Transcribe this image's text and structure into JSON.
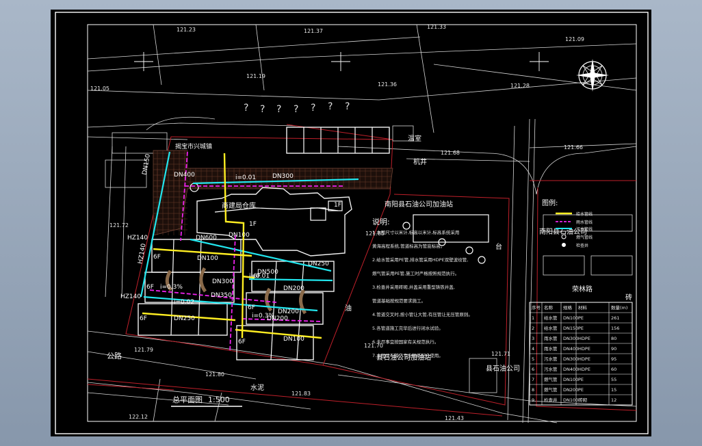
{
  "colors": {
    "background": "#000000",
    "frame": "#ffffff",
    "boundary": "#c0202a",
    "water_pipe": "#ffee22",
    "drain_pipe": "#22e6ee",
    "gas_pipe": "#ee22ee",
    "grid": "#7a4a3a"
  },
  "elevations": [
    "121.23",
    "121.37",
    "121.33",
    "121.09",
    "121.05",
    "121.19",
    "121.36",
    "121.28",
    "121.72",
    "121.79",
    "121.80",
    "121.83",
    "121.85",
    "121.70",
    "121.43",
    "122.12",
    "121.68",
    "121.66",
    "121.71"
  ],
  "site": {
    "neighbor_top": "揭宝市兴城镇",
    "warehouse": "商建局仓库",
    "gas_station": "南阳县石油公司加油站",
    "gas_station_lower": "县石油公司加油站",
    "oil_company": "南阳县石油公司",
    "oil_company_short": "县石油公司",
    "greenhouse": "温室",
    "pump": "机井",
    "street_right": "荣林路",
    "road_south": "公路",
    "road_surface": "水泥",
    "oil": "油",
    "tai": "台",
    "rai": "砖"
  },
  "pipes": [
    "DN400",
    "DN300",
    "DN600",
    "DN100",
    "DN250",
    "DN300",
    "DN350",
    "DN200",
    "DN100",
    "DN200",
    "DN500",
    "DN100",
    "DN150",
    "DN250",
    "DN200"
  ],
  "codes": [
    "HZ140",
    "HZ140",
    "HZ140",
    "i=0.01",
    "i=0.01",
    "i=0.02",
    "i=0.3%",
    "i=0.3%"
  ],
  "floor_tags": [
    "6F",
    "6F",
    "6F",
    "6F",
    "6F",
    "6F",
    "1F",
    "1F"
  ],
  "notes": {
    "title": "说明:",
    "lines": [
      "1.本图尺寸以米计,标高以米计,标高系统采用",
      "黄海高程系统,管道标高为管底标高。",
      "2.给水管采用PE管,排水管采用HDPE双壁波纹管,",
      "燃气管采用PE管,施工时严格按照规范执行。",
      "3.检查井采用砖砌,井盖采用重型铸铁井盖,",
      "管道基础按规范要求施工。",
      "4.管道交叉时,按小管让大管,有压管让无压管原则。",
      "5.各管道施工完毕后进行闭水试验。",
      "6.未尽事宜按国家有关规范执行。",
      "7.本图须与其它专业图纸配合使用。"
    ]
  },
  "legend": {
    "title": "图例:",
    "items": [
      "给水管线",
      "雨水管线",
      "污水管线",
      "燃气管线",
      "检查井"
    ]
  },
  "material_table": {
    "headers": [
      "序号",
      "名称",
      "规格",
      "材料",
      "数量(m)"
    ],
    "rows": [
      [
        "1",
        "给水管",
        "DN100",
        "PE",
        "261"
      ],
      [
        "2",
        "给水管",
        "DN150",
        "PE",
        "156"
      ],
      [
        "3",
        "雨水管",
        "DN300",
        "HDPE",
        "80"
      ],
      [
        "4",
        "雨水管",
        "DN400",
        "HDPE",
        "90"
      ],
      [
        "5",
        "污水管",
        "DN300",
        "HDPE",
        "95"
      ],
      [
        "6",
        "污水管",
        "DN400",
        "HDPE",
        "60"
      ],
      [
        "7",
        "燃气管",
        "DN100",
        "PE",
        "55"
      ],
      [
        "8",
        "燃气管",
        "DN200",
        "PE",
        "15"
      ],
      [
        "9",
        "检查井",
        "DN100",
        "砖砌",
        "12"
      ]
    ]
  },
  "title_block": {
    "plan_title": "总平面图",
    "scale": "1:500"
  }
}
